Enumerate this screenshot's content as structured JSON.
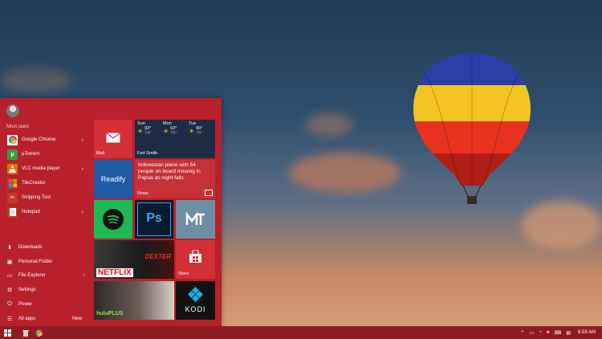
{
  "start_menu": {
    "most_used_label": "Most used",
    "apps": [
      {
        "label": "Google Chrome",
        "icon": "chrome-icon",
        "has_arrow": true
      },
      {
        "label": "µTorrent",
        "icon": "utorrent-icon",
        "has_arrow": false
      },
      {
        "label": "VLC media player",
        "icon": "vlc-icon",
        "has_arrow": true
      },
      {
        "label": "TileCreator",
        "icon": "tilecreator-icon",
        "has_arrow": false
      },
      {
        "label": "Snipping Tool",
        "icon": "scissors-icon",
        "has_arrow": false
      },
      {
        "label": "Notepad",
        "icon": "notepad-icon",
        "has_arrow": true
      }
    ],
    "places": [
      {
        "label": "Downloads",
        "icon": "download-icon"
      },
      {
        "label": "Personal Folder",
        "icon": "folder-icon"
      },
      {
        "label": "File Explorer",
        "icon": "file-explorer-icon"
      },
      {
        "label": "Settings",
        "icon": "gear-icon"
      },
      {
        "label": "Power",
        "icon": "power-icon"
      },
      {
        "label": "All apps",
        "icon": "list-icon"
      }
    ],
    "new_badge": "New"
  },
  "tiles": {
    "mail": {
      "label": "Mail"
    },
    "weather": {
      "location": "Fort Smith",
      "days": [
        {
          "day": "Sun",
          "high": "92°",
          "low": "74°"
        },
        {
          "day": "Mon",
          "high": "93°",
          "low": "75°"
        },
        {
          "day": "Tue",
          "high": "90°",
          "low": "75°"
        }
      ]
    },
    "readify": {
      "label": "Readify"
    },
    "news": {
      "headline": "Indonesian plane with 54 people on board missing in Papua as night falls",
      "label": "News"
    },
    "photoshop": {
      "label": "Ps"
    },
    "netflix": {
      "label": "NETFLIX",
      "poster_text": "DEXTER"
    },
    "store": {
      "label": "Store"
    },
    "hulu": {
      "label": "huluPLUS"
    },
    "kodi": {
      "label": "KODI"
    }
  },
  "taskbar": {
    "clock": "6:59 AM"
  },
  "colors": {
    "start_bg": "#b8202b",
    "tile_red": "#d32f37",
    "taskbar_bg": "#8f1b22"
  }
}
